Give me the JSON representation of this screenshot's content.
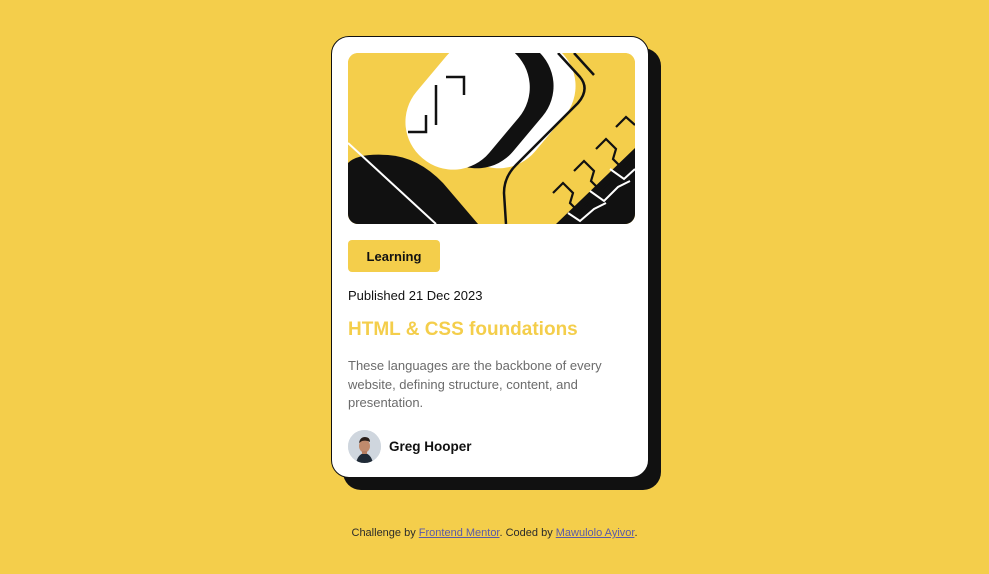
{
  "card": {
    "tag": "Learning",
    "published": "Published 21 Dec 2023",
    "title": "HTML & CSS foundations",
    "description": "These languages are the backbone of every website, defining structure, content, and presentation.",
    "author": "Greg Hooper"
  },
  "footer": {
    "prefix": "Challenge by ",
    "link1": "Frontend Mentor",
    "middle": ". Coded by ",
    "link2": "Mawulolo Ayivor",
    "suffix": "."
  },
  "colors": {
    "background": "#F4CE4B",
    "accent": "#F4CE4B",
    "text": "#111111",
    "muted": "#6B6B6B",
    "link": "#5a5aa8"
  },
  "icons": {
    "illustration": "abstract-illustration",
    "avatar": "avatar-photo"
  }
}
